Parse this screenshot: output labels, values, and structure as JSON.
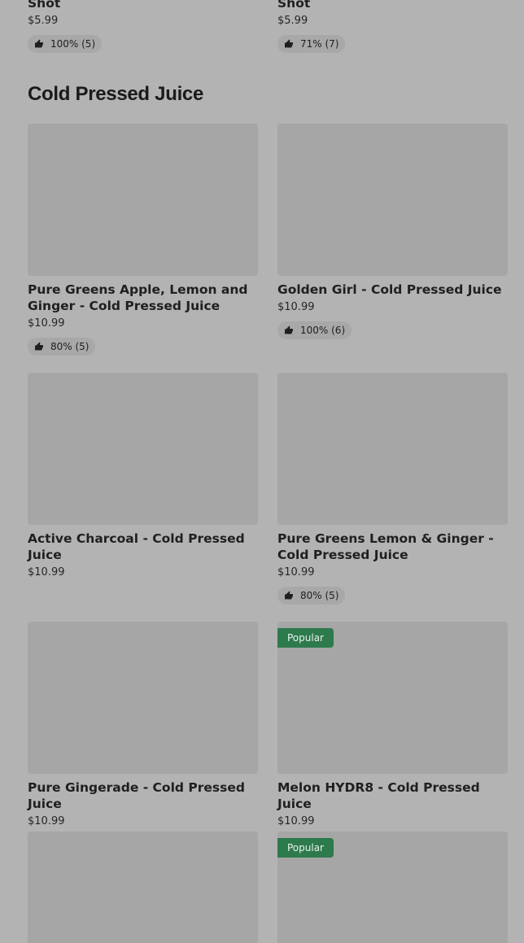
{
  "top_row": [
    {
      "title": "Shot",
      "price": "$5.99",
      "rating": "100% (5)"
    },
    {
      "title": "Shot",
      "price": "$5.99",
      "rating": "71% (7)"
    }
  ],
  "section": {
    "title": "Cold Pressed Juice"
  },
  "products": [
    {
      "title": "Pure Greens Apple, Lemon and Ginger - Cold Pressed Juice",
      "price": "$10.99",
      "rating": "80% (5)",
      "badge": ""
    },
    {
      "title": "Golden Girl - Cold Pressed Juice",
      "price": "$10.99",
      "rating": "100% (6)",
      "badge": ""
    },
    {
      "title": "Active Charcoal - Cold Pressed Juice",
      "price": "$10.99",
      "rating": "",
      "badge": ""
    },
    {
      "title": "Pure Greens Lemon & Ginger - Cold Pressed Juice",
      "price": "$10.99",
      "rating": "80% (5)",
      "badge": ""
    },
    {
      "title": "Pure Gingerade - Cold Pressed Juice",
      "price": "$10.99",
      "rating": "",
      "badge": ""
    },
    {
      "title": "Melon HYDR8 - Cold Pressed Juice",
      "price": "$10.99",
      "rating": "",
      "badge": "Popular"
    },
    {
      "title": "",
      "price": "",
      "rating": "",
      "badge": ""
    },
    {
      "title": "",
      "price": "",
      "rating": "",
      "badge": "Popular"
    }
  ],
  "icons": {
    "rating": "thumbs-up-icon"
  },
  "colors": {
    "background": "#b3b3b3",
    "thumb": "#a6a6a6",
    "badge": "#2d7a4d"
  }
}
